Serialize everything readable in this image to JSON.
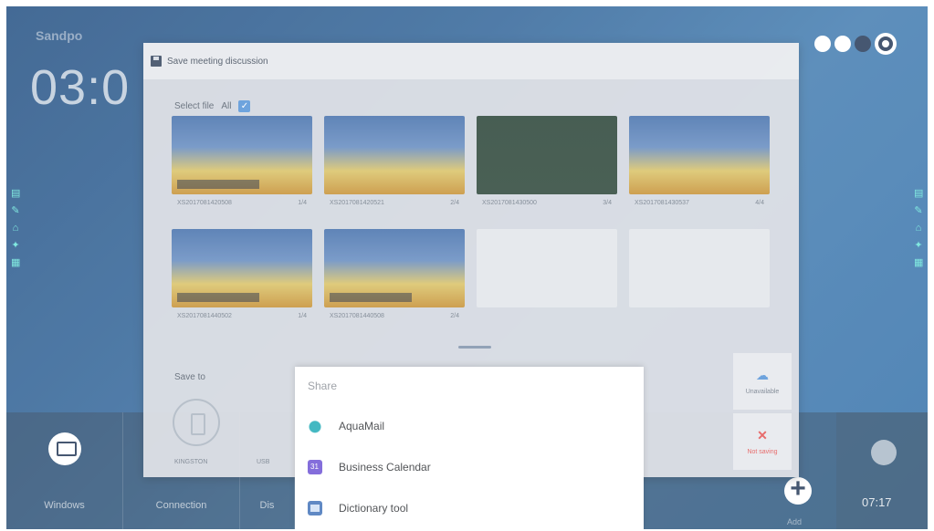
{
  "desktop": {
    "title": "Sandpo",
    "clock": "03:0",
    "taskbar": {
      "tiles": [
        "Windows",
        "Connection",
        "Dis"
      ],
      "add_label": "Add",
      "right_time": "07:17"
    }
  },
  "dialog": {
    "title": "Save meeting discussion",
    "select_file_label": "Select file",
    "all_label": "All",
    "thumbnails": [
      {
        "name": "XS2017081420508",
        "page": "1/4"
      },
      {
        "name": "XS2017081420521",
        "page": "2/4"
      },
      {
        "name": "XS2017081430500",
        "page": "3/4"
      },
      {
        "name": "XS2017081430537",
        "page": "4/4"
      },
      {
        "name": "XS2017081440502",
        "page": "1/4"
      },
      {
        "name": "XS2017081440508",
        "page": "2/4"
      }
    ],
    "save_to_label": "Save to",
    "usb_label": "KINGSTON",
    "usb_sub_label": "USB",
    "side_actions": {
      "cloud_label": "Unavailable",
      "close_label": "Not saving"
    }
  },
  "share": {
    "title": "Share",
    "items": [
      {
        "label": "AquaMail",
        "icon": "aquamail-icon"
      },
      {
        "label": "Business Calendar",
        "icon": "calendar-icon"
      },
      {
        "label": "Dictionary tool",
        "icon": "dictionary-icon"
      }
    ]
  },
  "colors": {
    "accent": "#4f8fd6",
    "side_icon": "#66e5d9",
    "danger": "#e24c4c"
  }
}
